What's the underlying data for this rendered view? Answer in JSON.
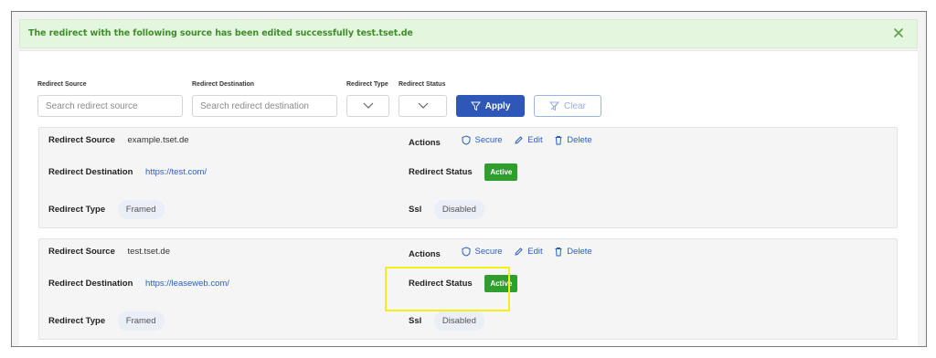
{
  "alert": {
    "message": "The redirect with the following source has been edited successfully test.tset.de"
  },
  "filters": {
    "source_label": "Redirect Source",
    "destination_label": "Redirect Destination",
    "type_label": "Redirect Type",
    "status_label": "Redirect Status",
    "source_placeholder": "Search redirect source",
    "destination_placeholder": "Search redirect destination",
    "apply_label": "Apply",
    "clear_label": "Clear"
  },
  "cards": [
    {
      "source_label": "Redirect Source",
      "source_value": "example.tset.de",
      "destination_label": "Redirect Destination",
      "destination_value": "https://test.com/",
      "type_label": "Redirect Type",
      "type_value": "Framed",
      "actions_label": "Actions",
      "secure_label": "Secure",
      "edit_label": "Edit",
      "delete_label": "Delete",
      "status_label": "Redirect Status",
      "status_value": "Active",
      "ssl_label": "Ssl",
      "ssl_value": "Disabled"
    },
    {
      "source_label": "Redirect Source",
      "source_value": "test.tset.de",
      "destination_label": "Redirect Destination",
      "destination_value": "https://leaseweb.com/",
      "type_label": "Redirect Type",
      "type_value": "Framed",
      "actions_label": "Actions",
      "secure_label": "Secure",
      "edit_label": "Edit",
      "delete_label": "Delete",
      "status_label": "Redirect Status",
      "status_value": "Active",
      "ssl_label": "Ssl",
      "ssl_value": "Disabled"
    }
  ],
  "icons": {
    "close": "close-icon",
    "filter": "filter-icon",
    "clear_filter": "clear-filter-icon",
    "shield": "shield-icon",
    "pencil": "pencil-icon",
    "trash": "trash-icon",
    "chevron": "chevron-down-icon"
  },
  "colors": {
    "accent": "#2e57b7",
    "success": "#2f9e2f",
    "link": "#2b5fc0",
    "alert_bg": "#e5f6df",
    "highlight": "#f4ef14"
  }
}
